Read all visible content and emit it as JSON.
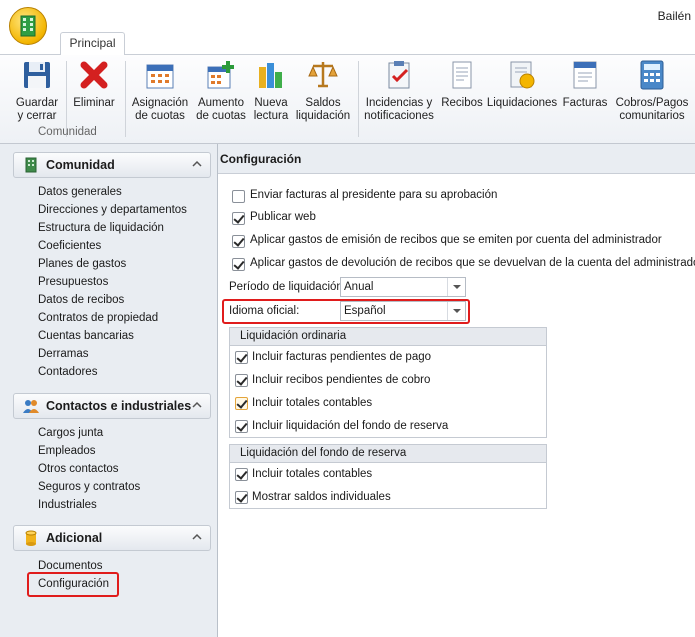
{
  "window": {
    "title_right": "Bailén"
  },
  "tabs": [
    {
      "label": "Principal"
    }
  ],
  "ribbon": {
    "group_label": "Comunidad",
    "buttons": [
      {
        "label1": "Guardar",
        "label2": "y cerrar",
        "icon": "floppy-disk-icon"
      },
      {
        "label1": "Eliminar",
        "label2": "",
        "icon": "red-x-icon"
      },
      {
        "label1": "Asignación",
        "label2": "de cuotas",
        "icon": "calendar-grid-icon"
      },
      {
        "label1": "Aumento",
        "label2": "de cuotas",
        "icon": "calendar-plus-icon"
      },
      {
        "label1": "Nueva",
        "label2": "lectura",
        "icon": "bar-chart-icon"
      },
      {
        "label1": "Saldos",
        "label2": "liquidación",
        "icon": "scales-icon"
      },
      {
        "label1": "Incidencias y",
        "label2": "notificaciones",
        "icon": "clipboard-check-icon"
      },
      {
        "label1": "Recibos",
        "label2": "",
        "icon": "receipt-icon"
      },
      {
        "label1": "Liquidaciones",
        "label2": "",
        "icon": "notebook-coin-icon"
      },
      {
        "label1": "Facturas",
        "label2": "",
        "icon": "invoice-icon"
      },
      {
        "label1": "Cobros/Pagos",
        "label2": "comunitarios",
        "icon": "calculator-icon"
      }
    ]
  },
  "nav": {
    "sections": [
      {
        "title": "Comunidad",
        "icon": "building-icon",
        "items": [
          "Datos generales",
          "Direcciones y departamentos",
          "Estructura de liquidación",
          "Coeficientes",
          "Planes de gastos",
          "Presupuestos",
          "Datos de recibos",
          "Contratos de propiedad",
          "Cuentas bancarias",
          "Derramas",
          "Contadores"
        ]
      },
      {
        "title": "Contactos e industriales",
        "icon": "people-icon",
        "items": [
          "Cargos junta",
          "Empleados",
          "Otros contactos",
          "Seguros y contratos",
          "Industriales"
        ]
      },
      {
        "title": "Adicional",
        "icon": "cylinder-icon",
        "items": [
          "Documentos",
          "Configuración"
        ]
      }
    ]
  },
  "main": {
    "header": "Configuración",
    "options": [
      {
        "label": "Enviar facturas al presidente para su aprobación",
        "checked": false
      },
      {
        "label": "Publicar web",
        "checked": true
      },
      {
        "label": "Aplicar gastos de emisión de recibos que se emiten por cuenta del administrador",
        "checked": true
      },
      {
        "label": "Aplicar gastos de devolución de recibos que se devuelvan de la cuenta del administrador",
        "checked": true
      }
    ],
    "periodo_label": "Período de liquidación:",
    "periodo_value": "Anual",
    "idioma_label": "Idioma oficial:",
    "idioma_value": "Español",
    "group1": {
      "title": "Liquidación ordinaria",
      "items": [
        {
          "label": "Incluir facturas pendientes de pago",
          "checked": true
        },
        {
          "label": "Incluir recibos pendientes de cobro",
          "checked": true
        },
        {
          "label": "Incluir totales contables",
          "checked": true
        },
        {
          "label": "Incluir liquidación del fondo de reserva",
          "checked": true
        }
      ]
    },
    "group2": {
      "title": "Liquidación del fondo de reserva",
      "items": [
        {
          "label": "Incluir totales contables",
          "checked": true
        },
        {
          "label": "Mostrar saldos individuales",
          "checked": true
        }
      ]
    }
  },
  "colors": {
    "highlight": "#e01c1c",
    "accent": "#f3b500"
  }
}
